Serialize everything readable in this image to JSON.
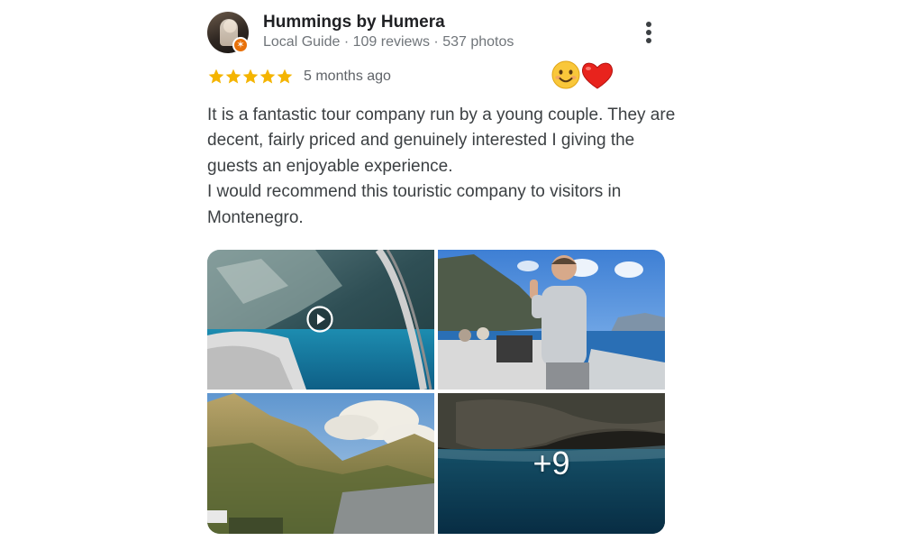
{
  "reviewer": {
    "name": "Hummings by Humera",
    "meta": "Local Guide · 109 reviews · 537 photos",
    "avatar_icon": "profile-avatar",
    "badge_icon": "local-guide-star-badge"
  },
  "rating": {
    "stars": 5,
    "max_stars": 5,
    "star_color": "#f4b400",
    "time": "5 months ago"
  },
  "reactions": [
    "smiling-face-emoji",
    "red-heart-emoji"
  ],
  "review": {
    "paragraphs": [
      "It is a fantastic tour company run by a young couple. They are decent, fairly priced and genuinely interested I giving the guests an enjoyable experience.",
      "I would recommend this touristic company to visitors in Montenegro."
    ]
  },
  "photos": {
    "items": [
      {
        "desc": "boat-cave-video",
        "is_video": true
      },
      {
        "desc": "man-on-boat-thumbs-up"
      },
      {
        "desc": "mountains-bay"
      },
      {
        "desc": "sea-cave"
      }
    ],
    "more_count": "+9"
  },
  "menu_icon": "more-vertical-icon"
}
